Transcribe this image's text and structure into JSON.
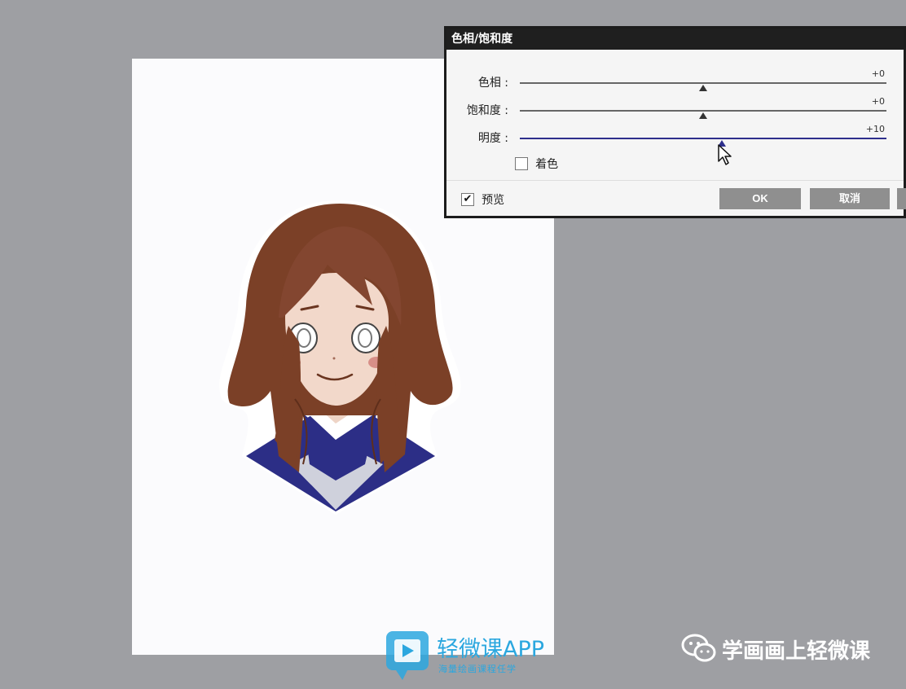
{
  "dialog": {
    "title": "色相/饱和度",
    "sliders": [
      {
        "label": "色相 :",
        "value": "+0",
        "position": 0.5
      },
      {
        "label": "饱和度 :",
        "value": "+0",
        "position": 0.5
      },
      {
        "label": "明度 :",
        "value": "+10",
        "position": 0.55
      }
    ],
    "colorize_label": "着色",
    "colorize_checked": false,
    "preview_label": "预览",
    "preview_checked": true,
    "ok_label": "OK",
    "cancel_label": "取消"
  },
  "watermark": {
    "app_name": "轻微课APP",
    "app_tagline": "海量绘画课程任学",
    "wechat_account": "学画画上轻微课"
  },
  "colors": {
    "workspace": "#9e9fa3",
    "paper": "#fbfbfd",
    "accent": "#2e2f8c",
    "watermark_blue": "#2ba7df"
  }
}
